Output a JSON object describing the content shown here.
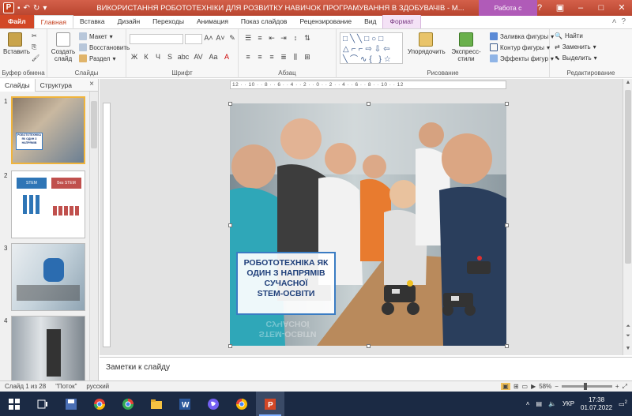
{
  "titlebar": {
    "app_icon": "P",
    "doc_title": "ВИКОРИСТАННЯ РОБОТОТЕХНІКИ ДЛЯ РОЗВИТКУ НАВИЧОК ПРОГРАМУВАННЯ В ЗДОБУВАЧІВ - M...",
    "context_tab_title": "Работа с рисунками",
    "window_controls": [
      "?",
      "▣",
      "–",
      "□",
      "✕"
    ]
  },
  "tabs": [
    {
      "label": "Файл"
    },
    {
      "label": "Главная"
    },
    {
      "label": "Вставка"
    },
    {
      "label": "Дизайн"
    },
    {
      "label": "Переходы"
    },
    {
      "label": "Анимация"
    },
    {
      "label": "Показ слайдов"
    },
    {
      "label": "Рецензирование"
    },
    {
      "label": "Вид"
    },
    {
      "label": "Формат"
    }
  ],
  "ribbon": {
    "clipboard": {
      "paste": "Вставить",
      "group": "Буфер обмена"
    },
    "slides": {
      "create": "Создать слайд",
      "layout": "Макет",
      "reset": "Восстановить",
      "section": "Раздел",
      "group": "Слайды"
    },
    "font": {
      "group": "Шрифт",
      "format_buttons": [
        "Ж",
        "К",
        "Ч",
        "S",
        "abc",
        "AV",
        "Aa",
        "A"
      ],
      "size_buttons": [
        "A˄",
        "A˅"
      ]
    },
    "paragraph": {
      "group": "Абзац"
    },
    "drawing": {
      "arrange": "Упорядочить",
      "quick_styles": "Экспресс-стили",
      "fill": "Заливка фигуры",
      "outline": "Контур фигуры",
      "effects": "Эффекты фигур",
      "group": "Рисование",
      "shape_rows": [
        "□╲╲□○□",
        "△⌐⌐⇨⇩⇦",
        "╲⌒∿{ }☆"
      ]
    },
    "editing": {
      "find": "Найти",
      "replace": "Заменить",
      "select": "Выделить",
      "group": "Редактирование"
    }
  },
  "pane": {
    "tab_slides": "Слайды",
    "tab_outline": "Структура",
    "close": "×",
    "thumbs": [
      {
        "num": "1",
        "mini_text": "РОБОТОТЕХНІКА ЯК ОДИН З НАПРЯМІВ"
      },
      {
        "num": "2",
        "mini_text_a": "STEM",
        "mini_text_b": "Без STEM"
      },
      {
        "num": "3"
      },
      {
        "num": "4"
      }
    ]
  },
  "ruler_labels": "12 · · 10 · · 8 · · 6 · · 4 · · 2 · · 0 · · 2 · · 4 · · 6 · · 8 · · 10 · · 12",
  "slide": {
    "title_lines": [
      "РОБОТОТЕХНІКА ЯК",
      "ОДИН З НАПРЯМІВ",
      "СУЧАСНОЇ",
      "STEM-ОСВІТИ"
    ],
    "reflection_lines": [
      "STEM-ОСВІТИ",
      "СУЧАСНОЇ"
    ]
  },
  "notes": {
    "placeholder": "Заметки к слайду"
  },
  "status": {
    "slide_info": "Слайд 1 из 28",
    "theme": "\"Поток\"",
    "language": "русский",
    "zoom": "58%"
  },
  "taskbar": {
    "lang": "УКР",
    "time": "17:38",
    "date": "01.07.2022",
    "notif_count": "2"
  },
  "colors": {
    "accent": "#d24726",
    "context": "#b05bb8",
    "slide_title": "#1f3f7a",
    "title_border": "#3a7cc3"
  }
}
